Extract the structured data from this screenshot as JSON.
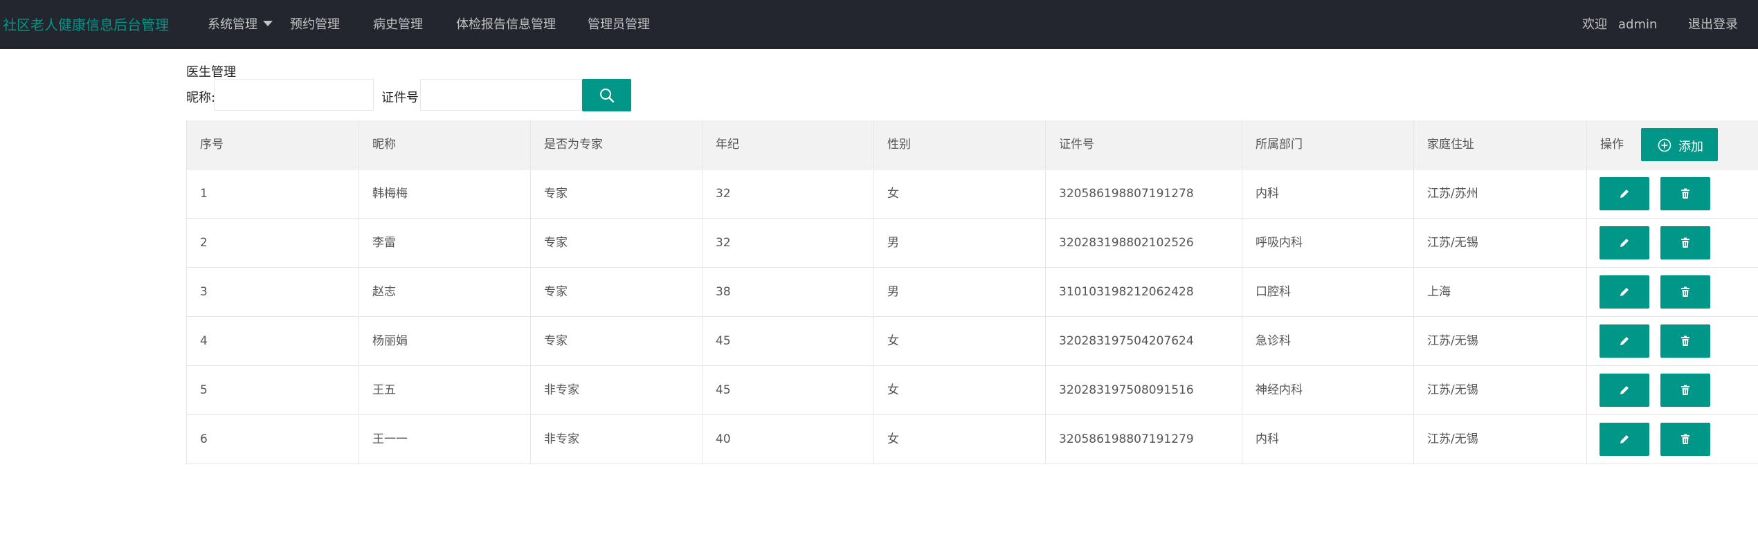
{
  "header": {
    "brand": "社区老人健康信息后台管理",
    "nav": [
      {
        "label": "系统管理",
        "has_dropdown": true
      },
      {
        "label": "预约管理"
      },
      {
        "label": "病史管理"
      },
      {
        "label": "体检报告信息管理"
      },
      {
        "label": "管理员管理"
      }
    ],
    "welcome_text": "欢迎",
    "username": "admin",
    "logout_label": "退出登录"
  },
  "page": {
    "title": "医生管理",
    "search": {
      "nickname_label": "昵称:",
      "nickname_value": "",
      "id_label": "证件号:",
      "id_value": "",
      "search_icon": "search-icon"
    }
  },
  "table": {
    "columns": [
      "序号",
      "昵称",
      "是否为专家",
      "年纪",
      "性别",
      "证件号",
      "所属部门",
      "家庭住址",
      "操作"
    ],
    "add_label": "添加",
    "rows": [
      [
        "1",
        "韩梅梅",
        "专家",
        "32",
        "女",
        "320586198807191278",
        "内科",
        "江苏/苏州"
      ],
      [
        "2",
        "李雷",
        "专家",
        "32",
        "男",
        "320283198802102526",
        "呼吸内科",
        "江苏/无锡"
      ],
      [
        "3",
        "赵志",
        "专家",
        "38",
        "男",
        "310103198212062428",
        "口腔科",
        "上海"
      ],
      [
        "4",
        "杨丽娟",
        "专家",
        "45",
        "女",
        "320283197504207624",
        "急诊科",
        "江苏/无锡"
      ],
      [
        "5",
        "王五",
        "非专家",
        "45",
        "女",
        "320283197508091516",
        "神经内科",
        "江苏/无锡"
      ],
      [
        "6",
        "王一一",
        "非专家",
        "40",
        "女",
        "320586198807191279",
        "内科",
        "江苏/无锡"
      ]
    ],
    "row_actions": [
      "edit-icon",
      "delete-icon"
    ]
  },
  "colors": {
    "header_bg": "#23262e",
    "accent": "#009688",
    "table_head_bg": "#f2f2f2",
    "border": "#e6e6e6"
  }
}
